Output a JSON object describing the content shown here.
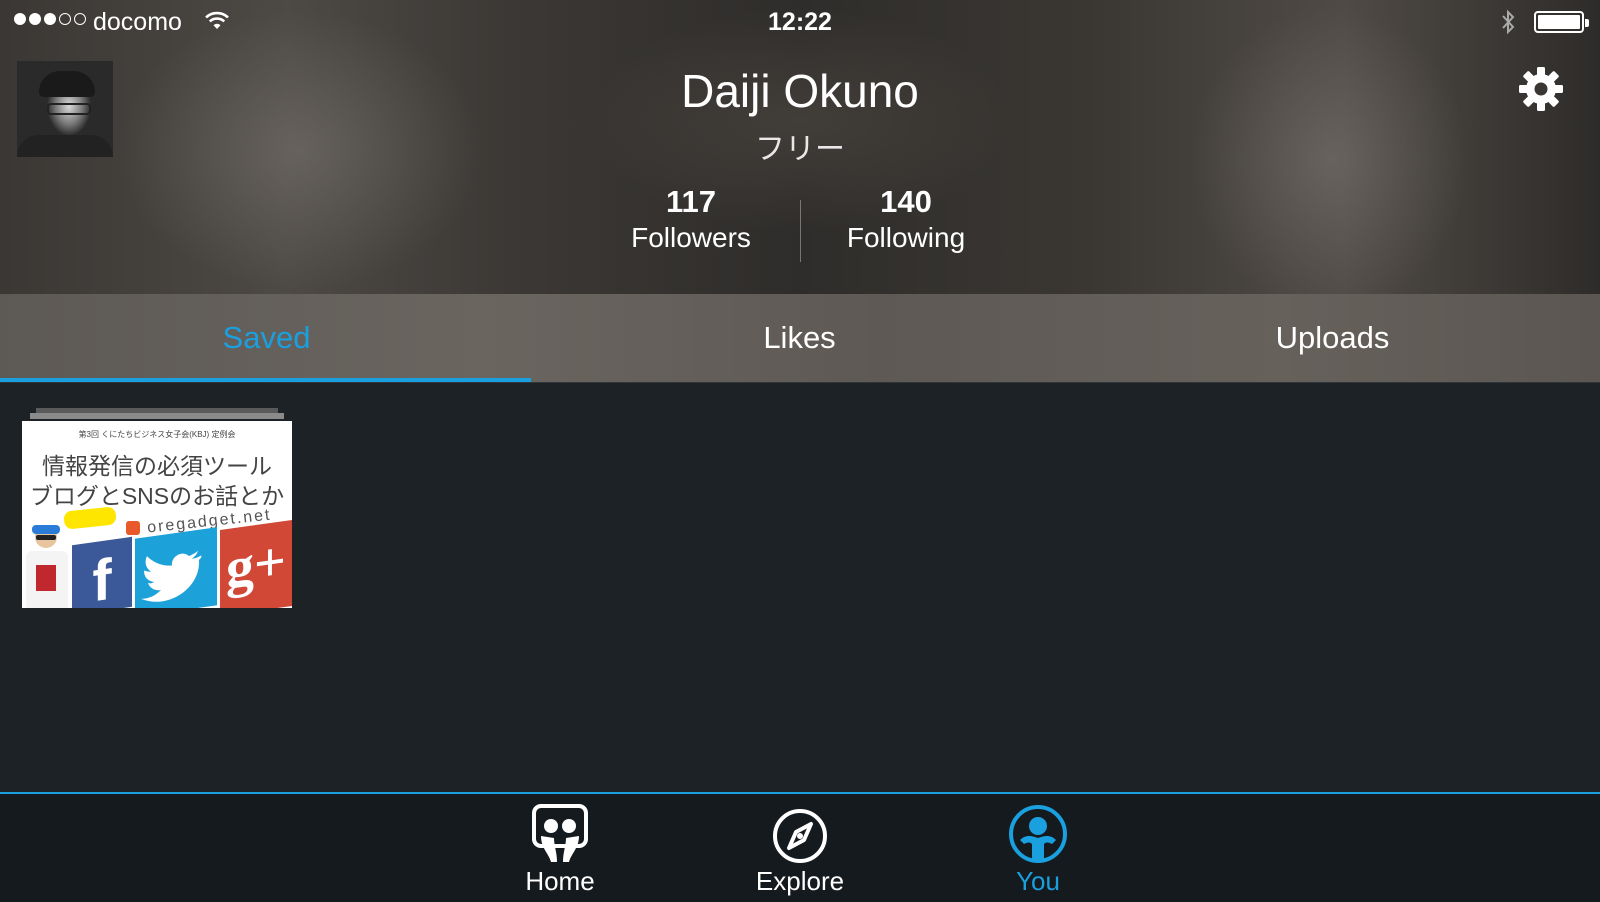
{
  "status_bar": {
    "signal": {
      "filled": 3,
      "total": 5
    },
    "carrier": "docomo",
    "time": "12:22"
  },
  "profile": {
    "name": "Daiji Okuno",
    "plan": "フリー",
    "followers": {
      "count": "117",
      "label": "Followers"
    },
    "following": {
      "count": "140",
      "label": "Following"
    }
  },
  "tabs": [
    {
      "label": "Saved",
      "active": true
    },
    {
      "label": "Likes",
      "active": false
    },
    {
      "label": "Uploads",
      "active": false
    }
  ],
  "saved_items": [
    {
      "subtitle": "第3回 くにたちビジネス女子会(KBJ) 定例会",
      "title_line1": "情報発信の必須ツール",
      "title_line2": "ブログとSNSのお話とか",
      "site": "oregadget.net"
    }
  ],
  "bottom_nav": [
    {
      "label": "Home",
      "icon": "home-icon",
      "active": false
    },
    {
      "label": "Explore",
      "icon": "compass-icon",
      "active": false
    },
    {
      "label": "You",
      "icon": "user-icon",
      "active": true
    }
  ],
  "colors": {
    "accent": "#1a9fdf",
    "background": "#1d2227",
    "nav_background": "#151a1e"
  }
}
